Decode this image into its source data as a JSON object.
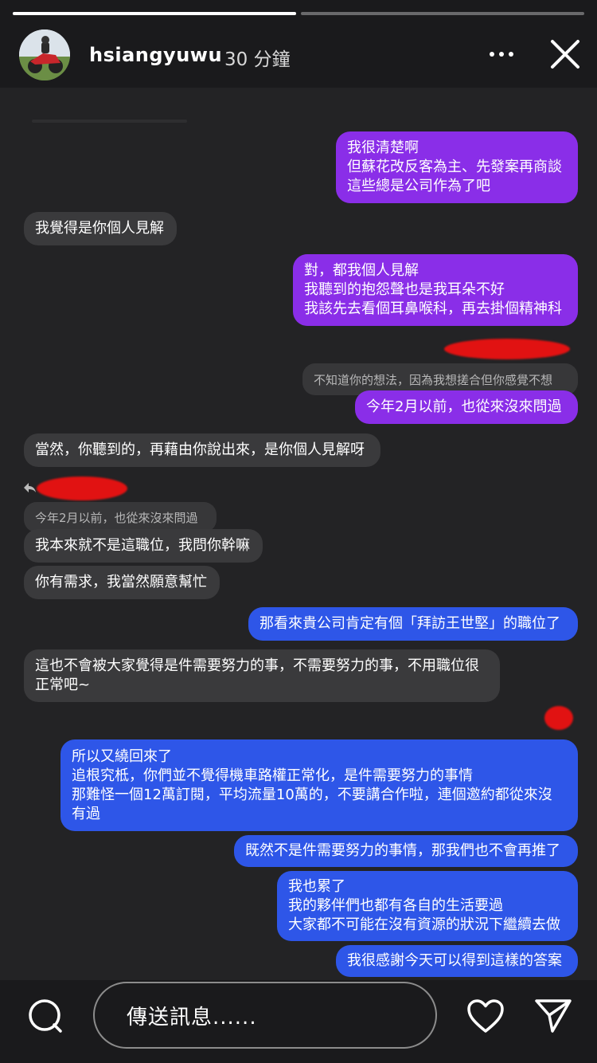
{
  "story": {
    "progress": [
      1.0,
      0.0
    ],
    "username": "hsiangyuwu",
    "time_ago": "30 分鐘"
  },
  "messages": {
    "m1": "我很清楚啊\n但蘇花改反客為主、先發案再商談\n這些總是公司作為了吧",
    "m2": "我覺得是你個人見解",
    "m3": "對，都我個人見解\n我聽到的抱怨聲也是我耳朵不好\n我該先去看個耳鼻喉科，再去掛個精神科",
    "q1": "不知道你的想法，因為我想搓合但你感覺不想",
    "m4": "今年2月以前，也從來沒來問過",
    "m5": "當然，你聽到的，再藉由你說出來，是你個人見解呀",
    "q2": "今年2月以前，也從來沒來問過",
    "m6": "我本來就不是這職位，我問你幹嘛",
    "m7": "你有需求，我當然願意幫忙",
    "m8": "那看來貴公司肯定有個「拜訪王世堅」的職位了",
    "m9": "這也不會被大家覺得是件需要努力的事，不需要努力的事，不用職位很\n正常吧~",
    "m10": "所以又繞回來了\n追根究柢，你們並不覺得機車路權正常化，是件需要努力的事情\n那難怪一個12萬訂閱，平均流量10萬的，不要講合作啦，連個邀約都從來沒\n有過",
    "m11": "既然不是件需要努力的事情，那我們也不會再推了",
    "m12": "我也累了\n我的夥伴們也都有各自的生活要過\n大家都不可能在沒有資源的狀況下繼續去做",
    "m13": "我很感謝今天可以得到這樣的答案"
  },
  "composer": {
    "placeholder": "傳送訊息......"
  },
  "icons": {
    "more": "more-horizontal-icon",
    "close": "close-icon",
    "camera": "camera-icon",
    "like": "heart-icon",
    "send": "send-icon"
  },
  "colors": {
    "sent_purple": "#8a2ee8",
    "sent_blue": "#2e56e8",
    "received": "#3a3a3c",
    "redaction": "#e11212"
  }
}
